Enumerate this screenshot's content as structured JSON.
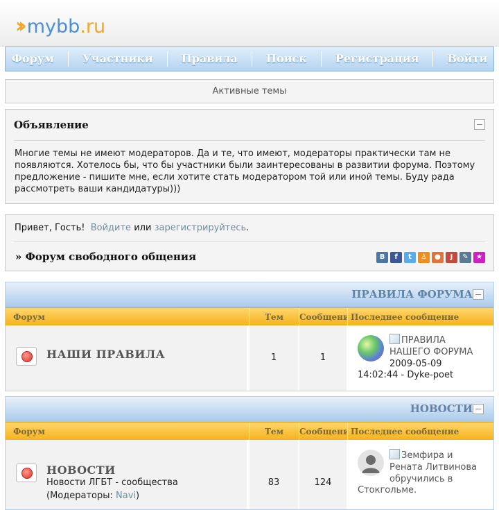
{
  "logo": {
    "part1": "mybb",
    "part2": ".ru"
  },
  "nav": [
    "Форум",
    "Участники",
    "Правила",
    "Поиск",
    "Регистрация",
    "Войти"
  ],
  "active_topics": "Активные темы",
  "announcement": {
    "title": "Объявление",
    "text": "Многие темы не имеют модераторов. Да и те, что имеют, модераторы практически там не появляются. Хотелось бы, что бы участники были заинтересованы в развитии форума. Поэтому предложение - пишите мне, если хотите стать модератором той или иной темы. Буду рада рассмотреть ваши кандидатуры)))"
  },
  "guest": {
    "greeting": "Привет, Гость!",
    "login_link": "Войдите",
    "or": "или",
    "register_link": "зарегистрируйтесь",
    "end": "."
  },
  "breadcrumb": "» Форум свободного общения",
  "share_icons": [
    {
      "name": "vkontakte-icon",
      "glyph": "В",
      "color": "#4a76a8"
    },
    {
      "name": "facebook-icon",
      "glyph": "f",
      "color": "#3b5998"
    },
    {
      "name": "twitter-icon",
      "glyph": "t",
      "color": "#55acee"
    },
    {
      "name": "odnoklassniki-icon",
      "glyph": "♙",
      "color": "#f28f1c"
    },
    {
      "name": "moimir-icon",
      "glyph": "●",
      "color": "#e2743a"
    },
    {
      "name": "livejournal-icon",
      "glyph": "J",
      "color": "#c44a3c"
    },
    {
      "name": "livejournal-pen-icon",
      "glyph": "✎",
      "color": "#5b7a94"
    },
    {
      "name": "favorite-star-icon",
      "glyph": "★",
      "color": "#d21fc4"
    }
  ],
  "columns": {
    "forum": "Форум",
    "topics": "Тем",
    "messages": "Сообщений",
    "last": "Последнее сообщение"
  },
  "categories": [
    {
      "title": "ПРАВИЛА ФОРУМА",
      "forums": [
        {
          "name": "НАШИ ПРАВИЛА",
          "topics": "1",
          "messages": "1",
          "last_line1": "ПРАВИЛА",
          "last_line2": "НАШЕГО ФОРУМА",
          "last_date": "2009-05-09",
          "last_time_author": "14:02:44 - Dyke-poet"
        }
      ]
    },
    {
      "title": "НОВОСТИ",
      "forums": [
        {
          "name": "НОВОСТИ",
          "description": "Новости ЛГБТ - сообщества",
          "moderators_label": "(Модераторы:",
          "moderator": "Navi",
          "moderators_end": ")",
          "topics": "83",
          "messages": "124",
          "last_line1": "Земфира и",
          "last_line2": "Рената Литвинова",
          "last_line3": "обручились в",
          "last_line4": "Стокгольме."
        }
      ]
    }
  ]
}
